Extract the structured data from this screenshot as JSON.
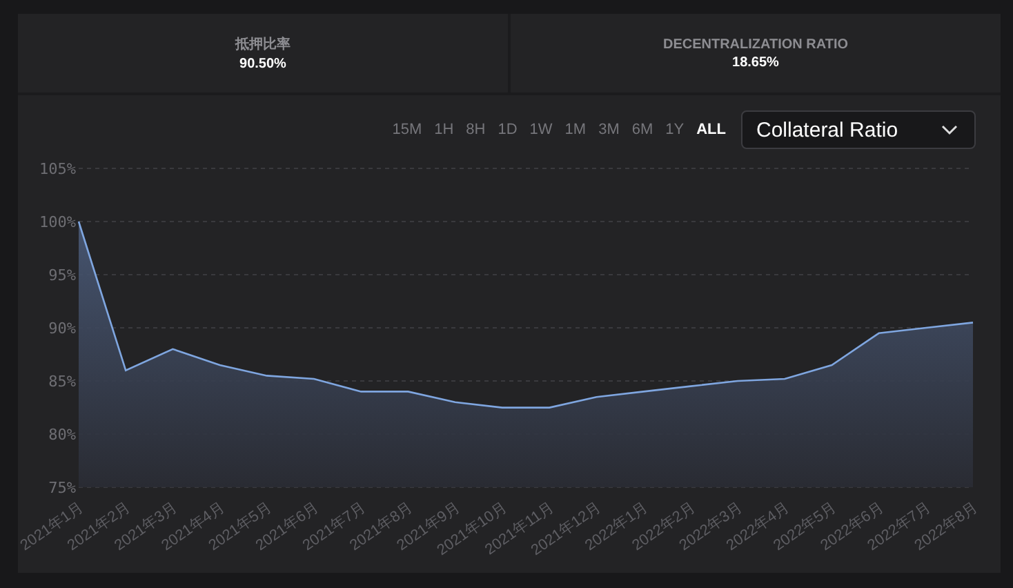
{
  "stats": [
    {
      "label": "抵押比率",
      "value": "90.50%"
    },
    {
      "label": "DECENTRALIZATION RATIO",
      "value": "18.65%"
    }
  ],
  "timeframes": [
    {
      "label": "15M",
      "selected": false
    },
    {
      "label": "1H",
      "selected": false
    },
    {
      "label": "8H",
      "selected": false
    },
    {
      "label": "1D",
      "selected": false
    },
    {
      "label": "1W",
      "selected": false
    },
    {
      "label": "1M",
      "selected": false
    },
    {
      "label": "3M",
      "selected": false
    },
    {
      "label": "6M",
      "selected": false
    },
    {
      "label": "1Y",
      "selected": false
    },
    {
      "label": "ALL",
      "selected": true
    }
  ],
  "metric_select": {
    "value": "Collateral Ratio"
  },
  "chart_data": {
    "type": "area",
    "categories": [
      "2021年1月",
      "2021年2月",
      "2021年3月",
      "2021年4月",
      "2021年5月",
      "2021年6月",
      "2021年7月",
      "2021年8月",
      "2021年9月",
      "2021年10月",
      "2021年11月",
      "2021年12月",
      "2022年1月",
      "2022年2月",
      "2022年3月",
      "2022年4月",
      "2022年5月",
      "2022年6月",
      "2022年7月",
      "2022年8月"
    ],
    "grid": true,
    "series": [
      {
        "color": "#7fa6e0",
        "values": [
          100,
          86,
          88,
          86.5,
          85.5,
          85.2,
          84,
          84,
          83,
          82.5,
          82.5,
          83.5,
          84,
          84.5,
          85,
          85.2,
          86.5,
          89.5,
          90,
          90.5
        ]
      }
    ],
    "ylim": [
      75,
      105
    ],
    "yticks": [
      {
        "value": 75,
        "label": "75%"
      },
      {
        "value": 80,
        "label": "80%"
      },
      {
        "value": 85,
        "label": "85%"
      },
      {
        "value": 90,
        "label": "90%"
      },
      {
        "value": 95,
        "label": "95%"
      },
      {
        "value": 100,
        "label": "100%"
      },
      {
        "value": 105,
        "label": "105%"
      }
    ]
  }
}
